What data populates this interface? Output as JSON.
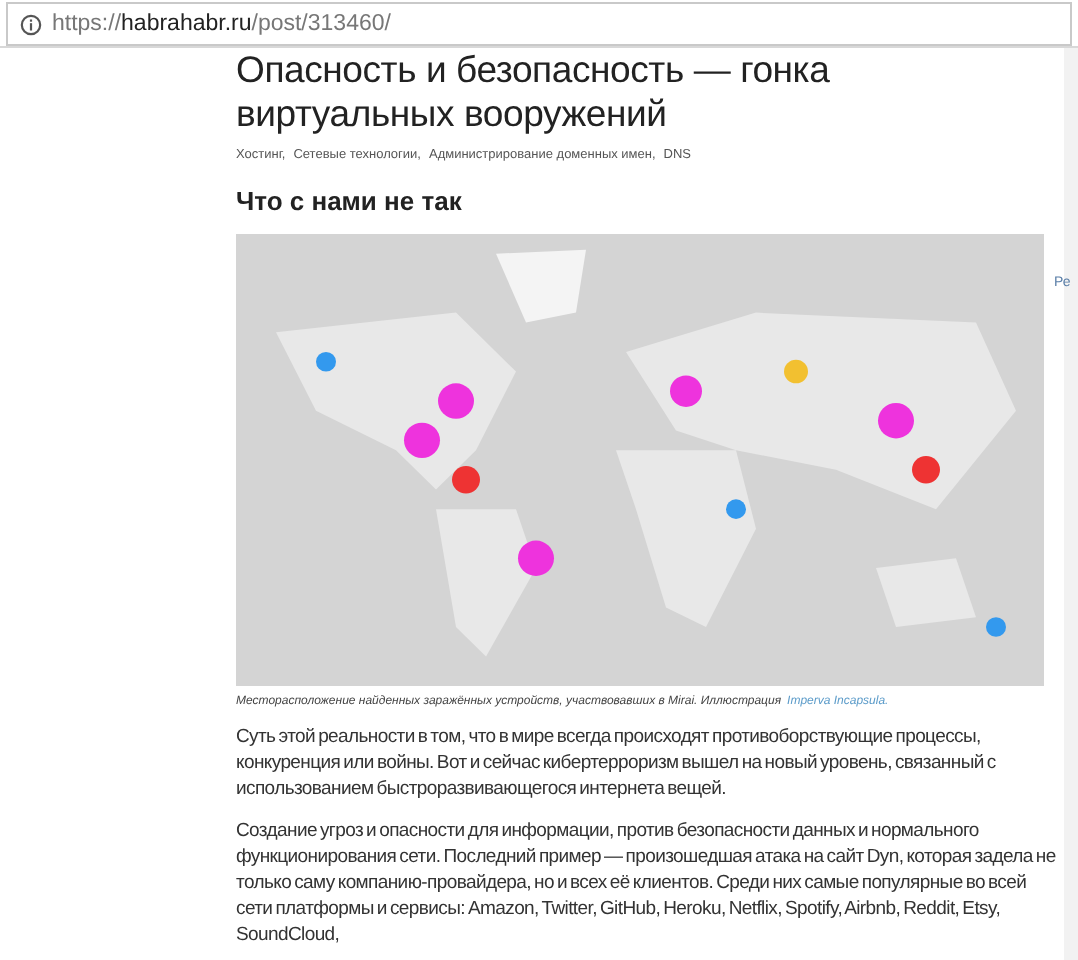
{
  "address_bar": {
    "url_prefix": "https://",
    "domain": "habrahabr.ru",
    "path": "/post/313460/"
  },
  "article": {
    "title": "Опасность и безопасность — гонка виртуальных вооружений",
    "hubs": [
      "Хостинг,",
      "Сетевые технологии,",
      "Администрирование доменных имен,",
      "DNS"
    ],
    "section_heading": "Что с нами не так",
    "figure": {
      "kind": "picture",
      "caption": "Месторасположение найденных заражённых устройств, участвовавших в Mirai. Иллюстрация",
      "caption_link": "Imperva Incapsula."
    },
    "paragraphs": [
      "Суть этой реальности в том, что в мире всегда происходят противоборствующие процессы, конкуренция или войны. Вот и сейчас кибертерроризм вышел на новый уровень, связанный с использованием быстроразвивающегося интернета вещей.",
      "Создание угроз и опасности для информации, против безопасности данных и нормального функционирования сети. Последний пример — произошедшая атака на сайт Dyn, которая задела не только саму компанию-провайдера, но и всех её клиентов. Среди них самые популярные во всей сети платформы и сервисы: Amazon, Twitter, GitHub, Heroku, Netflix, Spotify, Airbnb, Reddit, Etsy, SoundCloud,"
    ]
  },
  "sidebar": {
    "cut_label": "Ре"
  }
}
